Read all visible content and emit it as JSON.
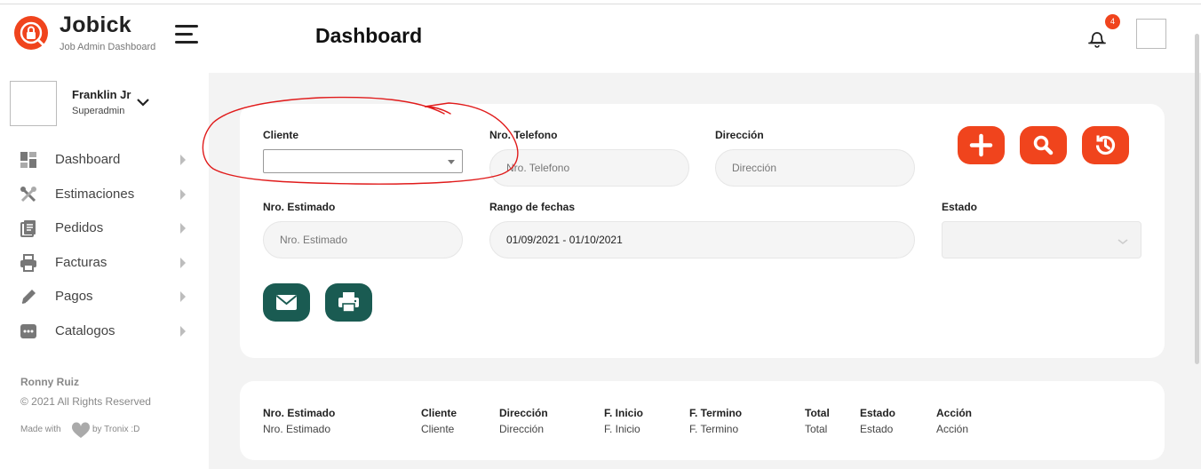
{
  "app": {
    "name": "Jobick",
    "subtitle": "Job Admin Dashboard"
  },
  "header": {
    "title": "Dashboard",
    "notification_count": "4"
  },
  "user": {
    "name": "Franklin Jr",
    "role": "Superadmin"
  },
  "sidebar": {
    "items": [
      {
        "label": "Dashboard",
        "icon": "grid-icon"
      },
      {
        "label": "Estimaciones",
        "icon": "tools-icon"
      },
      {
        "label": "Pedidos",
        "icon": "book-icon"
      },
      {
        "label": "Facturas",
        "icon": "printer-icon"
      },
      {
        "label": "Pagos",
        "icon": "pencil-icon"
      },
      {
        "label": "Catalogos",
        "icon": "dots-icon"
      }
    ],
    "footer": {
      "name": "Ronny Ruiz",
      "copyright": "© 2021 All Rights Reserved",
      "made_with": "Made with",
      "by": "by Tronix :D"
    }
  },
  "filters": {
    "cliente_label": "Cliente",
    "telefono_label": "Nro. Telefono",
    "telefono_placeholder": "Nro. Telefono",
    "direccion_label": "Dirección",
    "direccion_placeholder": "Dirección",
    "estimado_label": "Nro. Estimado",
    "estimado_placeholder": "Nro. Estimado",
    "rango_label": "Rango de fechas",
    "rango_value": "01/09/2021 - 01/10/2021",
    "estado_label": "Estado"
  },
  "actions": [
    {
      "name": "add-button",
      "icon": "plus-icon"
    },
    {
      "name": "search-button",
      "icon": "search-icon"
    },
    {
      "name": "history-button",
      "icon": "history-icon"
    },
    {
      "name": "email-button",
      "icon": "envelope-icon"
    },
    {
      "name": "print-button",
      "icon": "printer-icon"
    }
  ],
  "table": {
    "headers": [
      "Nro. Estimado",
      "Cliente",
      "Dirección",
      "F. Inicio",
      "F. Termino",
      "Total",
      "Estado",
      "Acción"
    ],
    "row": [
      "Nro. Estimado",
      "Cliente",
      "Dirección",
      "F. Inicio",
      "F. Termino",
      "Total",
      "Estado",
      "Acción"
    ]
  },
  "colors": {
    "accent": "#f0441d",
    "dark_green": "#1a5b52",
    "annotation": "#e01b1b"
  }
}
